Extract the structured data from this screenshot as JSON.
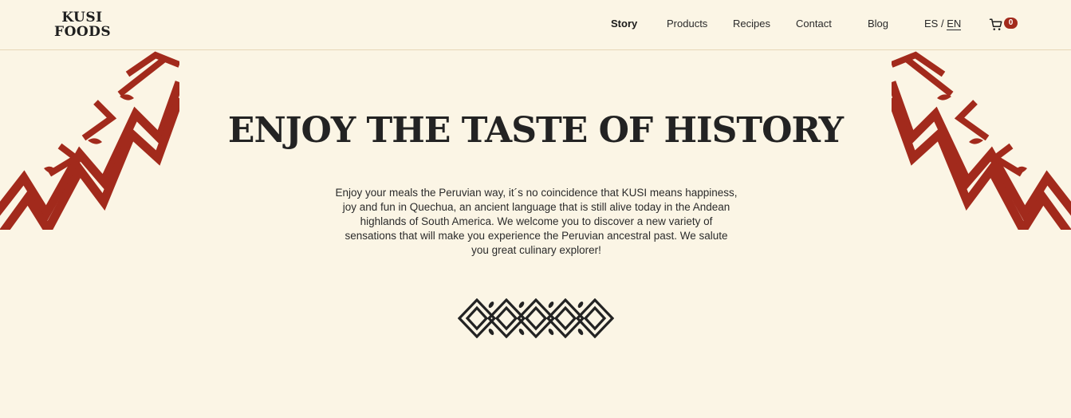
{
  "header": {
    "logo_line1": "KUSI",
    "logo_line2": "FOODS",
    "nav": {
      "story": "Story",
      "products": "Products",
      "recipes": "Recipes",
      "contact": "Contact",
      "blog": "Blog"
    },
    "lang": {
      "es": "ES",
      "separator": " / ",
      "en": "EN"
    },
    "cart_count": "0"
  },
  "hero": {
    "title": "ENJOY THE TASTE OF HISTORY",
    "text": "Enjoy your meals the Peruvian way, it´s no coincidence that KUSI means happiness, joy and fun in Quechua, an ancient language that is still alive today in the Andean highlands of South America. We welcome you to discover a new variety of sensations that will make you experience the Peruvian ancestral past. We salute you great culinary explorer!"
  },
  "colors": {
    "background": "#fbf5e5",
    "accent_red": "#a22a1c",
    "text_dark": "#232323"
  },
  "icons": {
    "cart": "shopping-cart-icon",
    "pattern": "andean-zigzag-pepper-pattern",
    "ornament": "diamond-chain-ornament"
  }
}
